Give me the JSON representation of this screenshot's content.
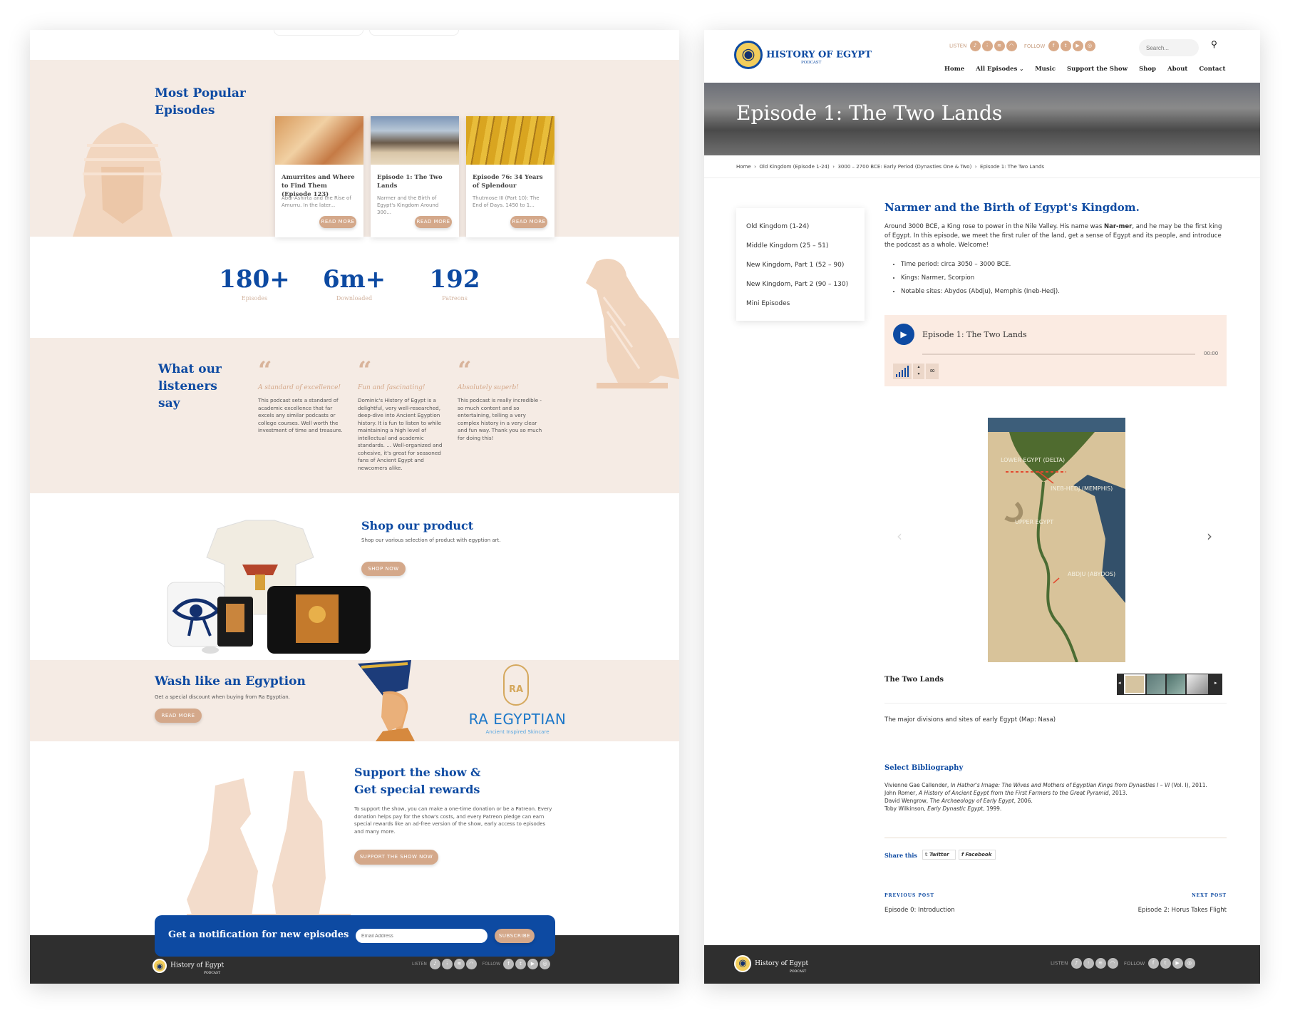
{
  "left": {
    "popular": {
      "title": "Most Popular Episodes",
      "cards": [
        {
          "title": "Amurrites and Where to Find Them (Episode 123)",
          "excerpt": "Abdi-Ashirta and the Rise of Amurru. In the later...",
          "button": "READ MORE"
        },
        {
          "title": "Episode 1: The Two Lands",
          "excerpt": "Narmer and the Birth of Egypt's Kingdom Around 300...",
          "button": "READ MORE"
        },
        {
          "title": "Episode 76: 34 Years of Splendour",
          "excerpt": "Thutmose III (Part 10): The End of Days. 1450 to 1...",
          "button": "READ MORE"
        }
      ]
    },
    "stats": [
      {
        "value": "180+",
        "label": "Episodes"
      },
      {
        "value": "6m+",
        "label": "Downloaded"
      },
      {
        "value": "192",
        "label": "Patreons"
      }
    ],
    "testimonials": {
      "title": "What our listeners say",
      "items": [
        {
          "heading": "A standard of excellence!",
          "body": "This podcast sets a standard of academic excellence that far excels any similar podcasts or college courses. Well worth the investment of time and treasure."
        },
        {
          "heading": "Fun and fascinating!",
          "body": "Dominic's History of Egypt is a delightful, very well-researched, deep-dive into Ancient Egyption history. It is fun to listen to while maintaining a high level of intellectual and academic standards. ... Well-organized and cohesive, it's great for seasoned fans of Ancient Egypt and newcomers alike."
        },
        {
          "heading": "Absolutely superb!",
          "body": "This podcast is really incredible - so much content and so entertaining, telling a very complex history in a very clear and fun way. Thank you so much for doing this!"
        }
      ]
    },
    "shop": {
      "title": "Shop our product",
      "text": "Shop our various selection of product with egyption art.",
      "button": "SHOP NOW"
    },
    "wash": {
      "title": "Wash like an Egyption",
      "text": "Get a special discount when buying from Ra Egyptian.",
      "button": "READ MORE",
      "brand": "RA EGYPTIAN",
      "tagline": "Ancient Inspired Skincare",
      "logo_letters": "RA"
    },
    "support": {
      "title1": "Support the show &",
      "title2": "Get special rewards",
      "text": "To support the show, you can make a one-time donation or be a Patreon. Every donation helps pay for the show's costs, and every Patreon pledge can earn special rewards like an ad-free version of the show, early access to episodes and many more.",
      "button": "SUPPORT THE SHOW NOW"
    },
    "newsletter": {
      "title": "Get a notification for new episodes",
      "placeholder": "Email Address",
      "button": "SUBSCRIBE"
    },
    "footer": {
      "logo": "History of Egypt",
      "logo_sub": "Podcast",
      "listen": "LISTEN",
      "follow": "FOLLOW"
    }
  },
  "right": {
    "header": {
      "logo": "History of Egypt",
      "logo_sub": "Podcast",
      "listen": "LISTEN",
      "follow": "FOLLOW",
      "search_placeholder": "Search...",
      "nav": [
        "Home",
        "All Episodes",
        "Music",
        "Support the Show",
        "Shop",
        "About",
        "Contact"
      ]
    },
    "hero_title": "Episode 1: The Two Lands",
    "breadcrumb": [
      "Home",
      "Old Kingdom (Episode 1-24)",
      "3000 – 2700 BCE: Early Period (Dynasties One & Two)",
      "Episode 1: The Two Lands"
    ],
    "sidebar": [
      "Old Kingdom (1-24)",
      "Middle Kingdom (25 – 51)",
      "New Kingdom, Part 1 (52 – 90)",
      "New Kingdom, Part 2 (90 – 130)",
      "Mini Episodes"
    ],
    "article": {
      "heading": "Narmer and the Birth of Egypt's Kingdom.",
      "intro_a": "Around 3000 BCE, a King rose to power in the Nile Valley. His name was ",
      "intro_name": "Nar-mer",
      "intro_b": ", and he may be the first king of Egypt. In this episode, we meet the first ruler of the land, get a sense of Egypt and its people, and introduce the podcast as a whole. Welcome!",
      "bullets": [
        "Time period: circa 3050 – 3000 BCE.",
        "Kings: Narmer, Scorpion",
        "Notable sites: Abydos (Abdju), Memphis (Ineb-Hedj)."
      ]
    },
    "player": {
      "title": "Episode 1: The Two Lands",
      "time": "00:00"
    },
    "map_labels": [
      "LOWER EGYPT (DELTA)",
      "INEB-HEDJ (MEMPHIS)",
      "UPPER EGYPT",
      "ABDJU (ABYDOS)"
    ],
    "gallery": {
      "title": "The Two Lands",
      "caption": "The major divisions and sites of early Egypt (Map: Nasa)"
    },
    "bibliography": {
      "title": "Select Bibliography",
      "items": [
        {
          "author": "Vivienne Gae Callender, ",
          "work": "In Hathor's Image: The Wives and Mothers of Egyptian Kings from Dynasties I – VI",
          "rest": " (Vol. I), 2011."
        },
        {
          "author": "John Romer, ",
          "work": "A History of Ancient Egypt from the First Farmers to the Great Pyramid",
          "rest": ", 2013."
        },
        {
          "author": "David Wengrow, ",
          "work": "The Archaeology of Early Egypt",
          "rest": ", 2006."
        },
        {
          "author": "Toby Wilkinson, ",
          "work": "Early Dynastic Egypt",
          "rest": ", 1999."
        }
      ]
    },
    "share": {
      "label": "Share this",
      "twitter": "Twitter",
      "facebook": "Facebook"
    },
    "postnav": {
      "prev_label": "PREVIOUS POST",
      "prev": "Episode 0: Introduction",
      "next_label": "NEXT POST",
      "next": "Episode 2: Horus Takes Flight"
    },
    "footer": {
      "logo": "History of Egypt",
      "logo_sub": "Podcast",
      "listen": "LISTEN",
      "follow": "FOLLOW"
    }
  }
}
